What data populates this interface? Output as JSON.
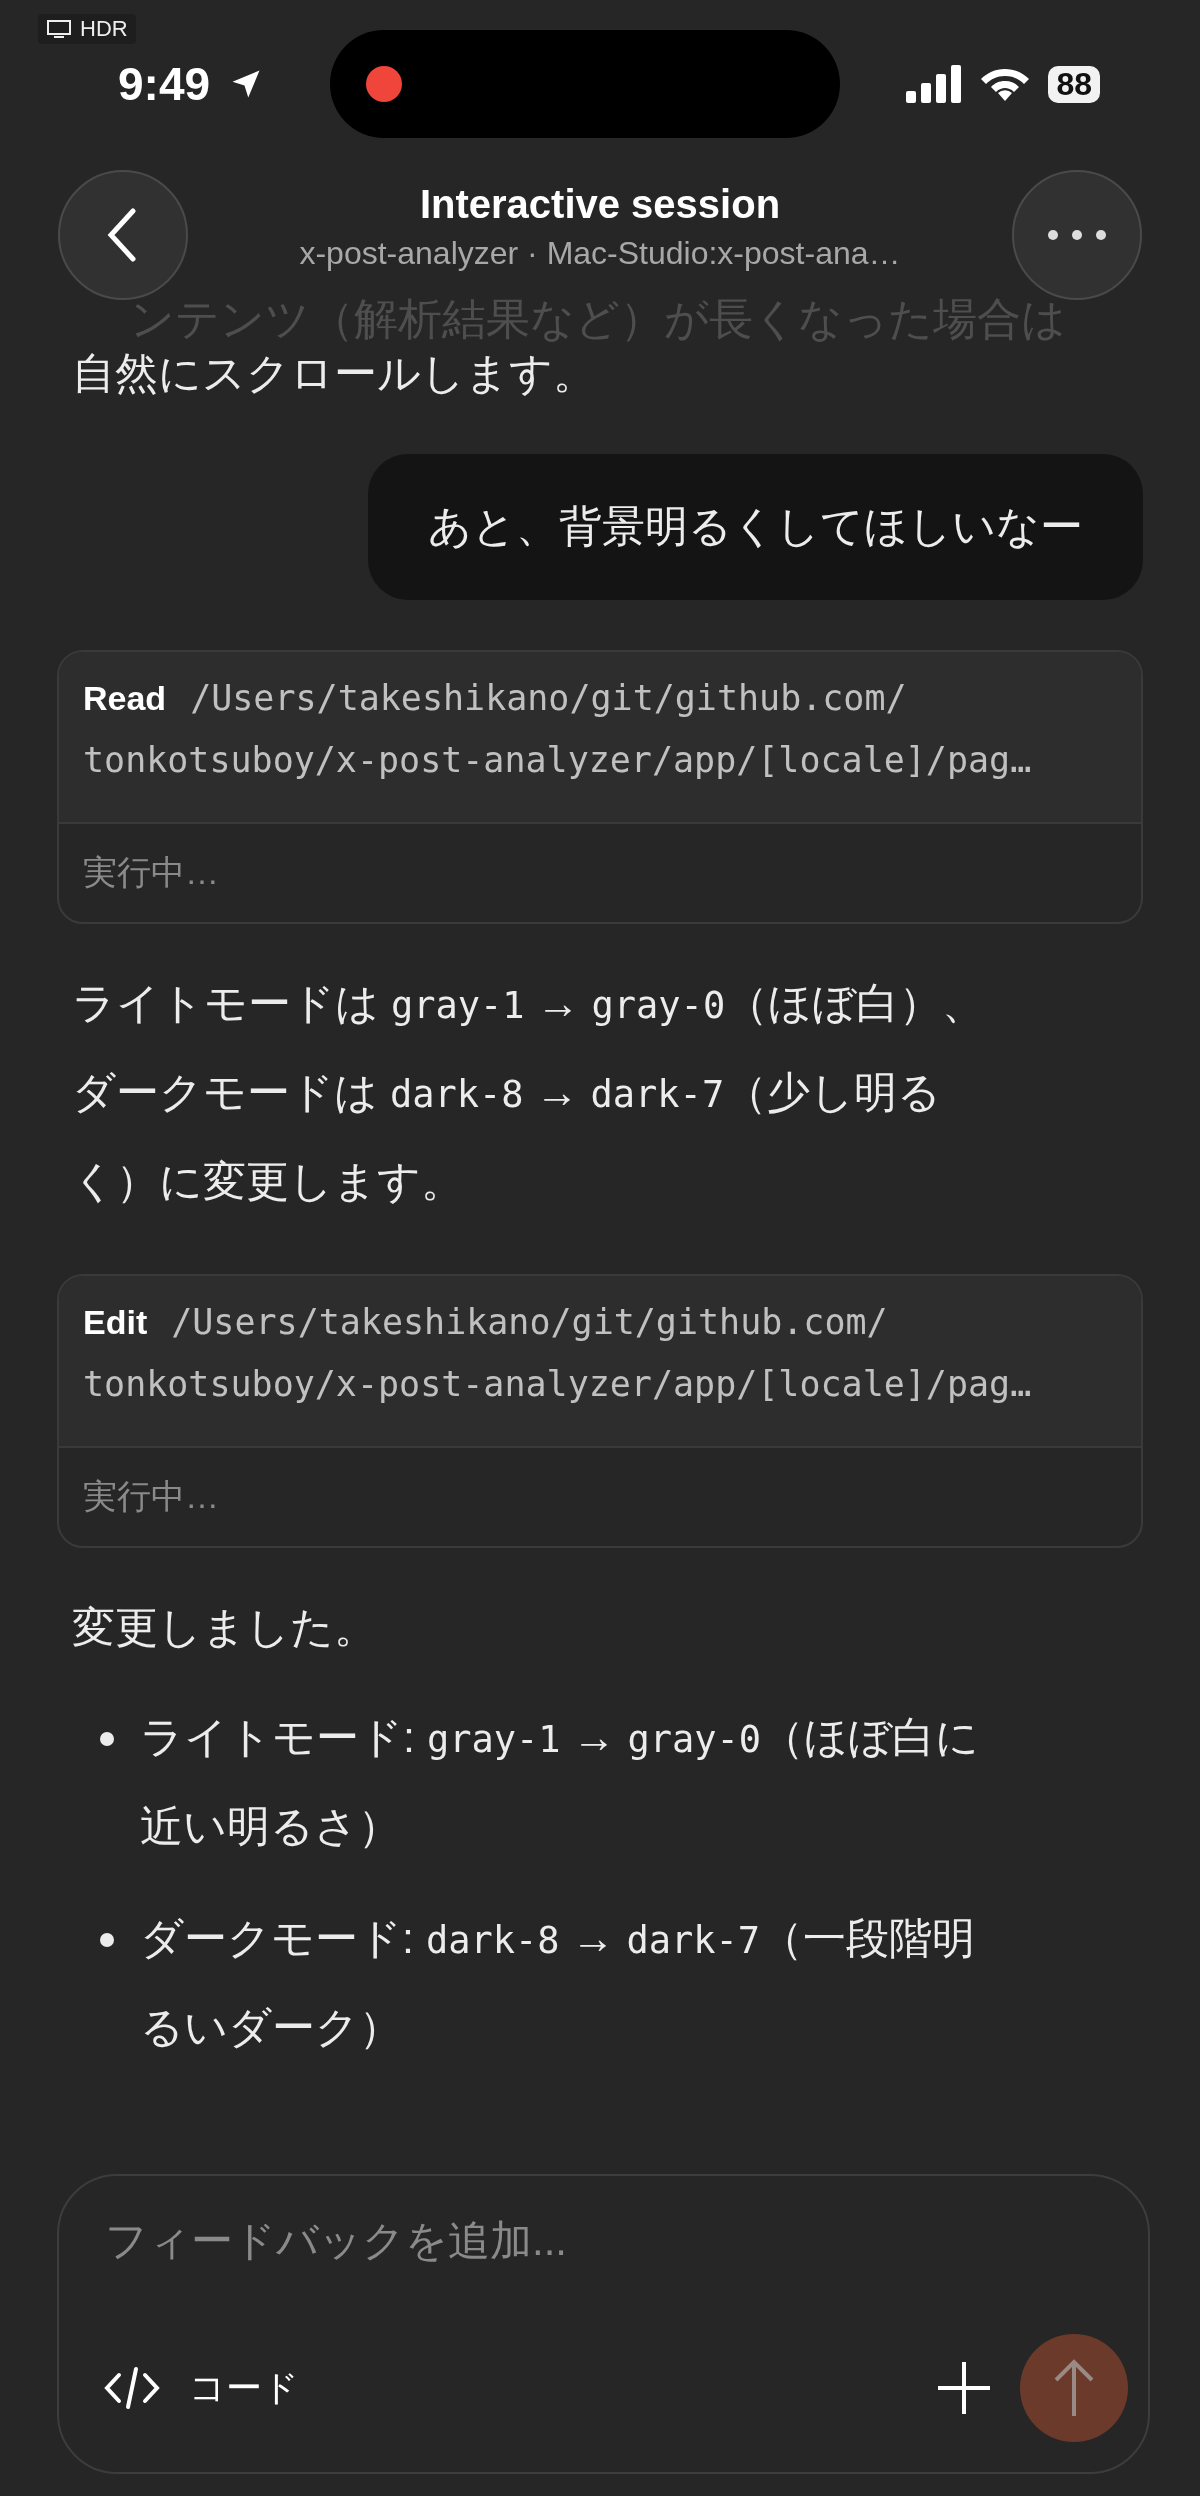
{
  "status_bar": {
    "hdr": "HDR",
    "time": "9:49",
    "battery": "88",
    "recording": true
  },
  "header": {
    "title": "Interactive session",
    "subtitle": "x-post-analyzer · Mac-Studio:x-post-ana…"
  },
  "faded_text": "ンテンツ（解析結果など）が長くなった場合は",
  "messages": [
    {
      "kind": "text",
      "lines": [
        [
          {
            "t": "自然にスクロールします。",
            "code": false
          }
        ]
      ]
    },
    {
      "kind": "user",
      "text": "あと、背景明るくしてほしいなー"
    },
    {
      "kind": "tool",
      "tool": "Read",
      "path_lines": [
        "/Users/takeshikano/git/github.com/",
        "tonkotsuboy/x-post-analyzer/app/[locale]/pag…"
      ],
      "status": "実行中…"
    },
    {
      "kind": "text",
      "lines": [
        [
          {
            "t": "ライトモードは ",
            "code": false
          },
          {
            "t": "gray-1",
            "code": true
          },
          {
            "t": " → ",
            "code": false
          },
          {
            "t": "gray-0",
            "code": true
          },
          {
            "t": "（ほぼ白）、",
            "code": false
          }
        ],
        [
          {
            "t": "ダークモードは ",
            "code": false
          },
          {
            "t": "dark-8",
            "code": true
          },
          {
            "t": " → ",
            "code": false
          },
          {
            "t": "dark-7",
            "code": true
          },
          {
            "t": "（少し明る",
            "code": false
          }
        ],
        [
          {
            "t": "く）に変更します。",
            "code": false
          }
        ]
      ]
    },
    {
      "kind": "tool",
      "tool": "Edit",
      "path_lines": [
        "/Users/takeshikano/git/github.com/",
        "tonkotsuboy/x-post-analyzer/app/[locale]/pag…"
      ],
      "status": "実行中…"
    },
    {
      "kind": "text",
      "lines": [
        [
          {
            "t": "変更しました。",
            "code": false
          }
        ]
      ]
    },
    {
      "kind": "bullets",
      "items": [
        {
          "lines": [
            [
              {
                "t": "ライトモード: ",
                "code": false
              },
              {
                "t": "gray-1",
                "code": true
              },
              {
                "t": " → ",
                "code": false
              },
              {
                "t": "gray-0",
                "code": true
              },
              {
                "t": "（ほぼ白に",
                "code": false
              }
            ],
            [
              {
                "t": "近い明るさ）",
                "code": false
              }
            ]
          ]
        },
        {
          "lines": [
            [
              {
                "t": "ダークモード: ",
                "code": false
              },
              {
                "t": "dark-8",
                "code": true
              },
              {
                "t": " → ",
                "code": false
              },
              {
                "t": "dark-7",
                "code": true
              },
              {
                "t": "（一段階明",
                "code": false
              }
            ],
            [
              {
                "t": "るいダーク）",
                "code": false
              }
            ]
          ]
        }
      ]
    }
  ],
  "composer": {
    "placeholder": "フィードバックを追加...",
    "mode": "コード",
    "send_disabled": true
  }
}
